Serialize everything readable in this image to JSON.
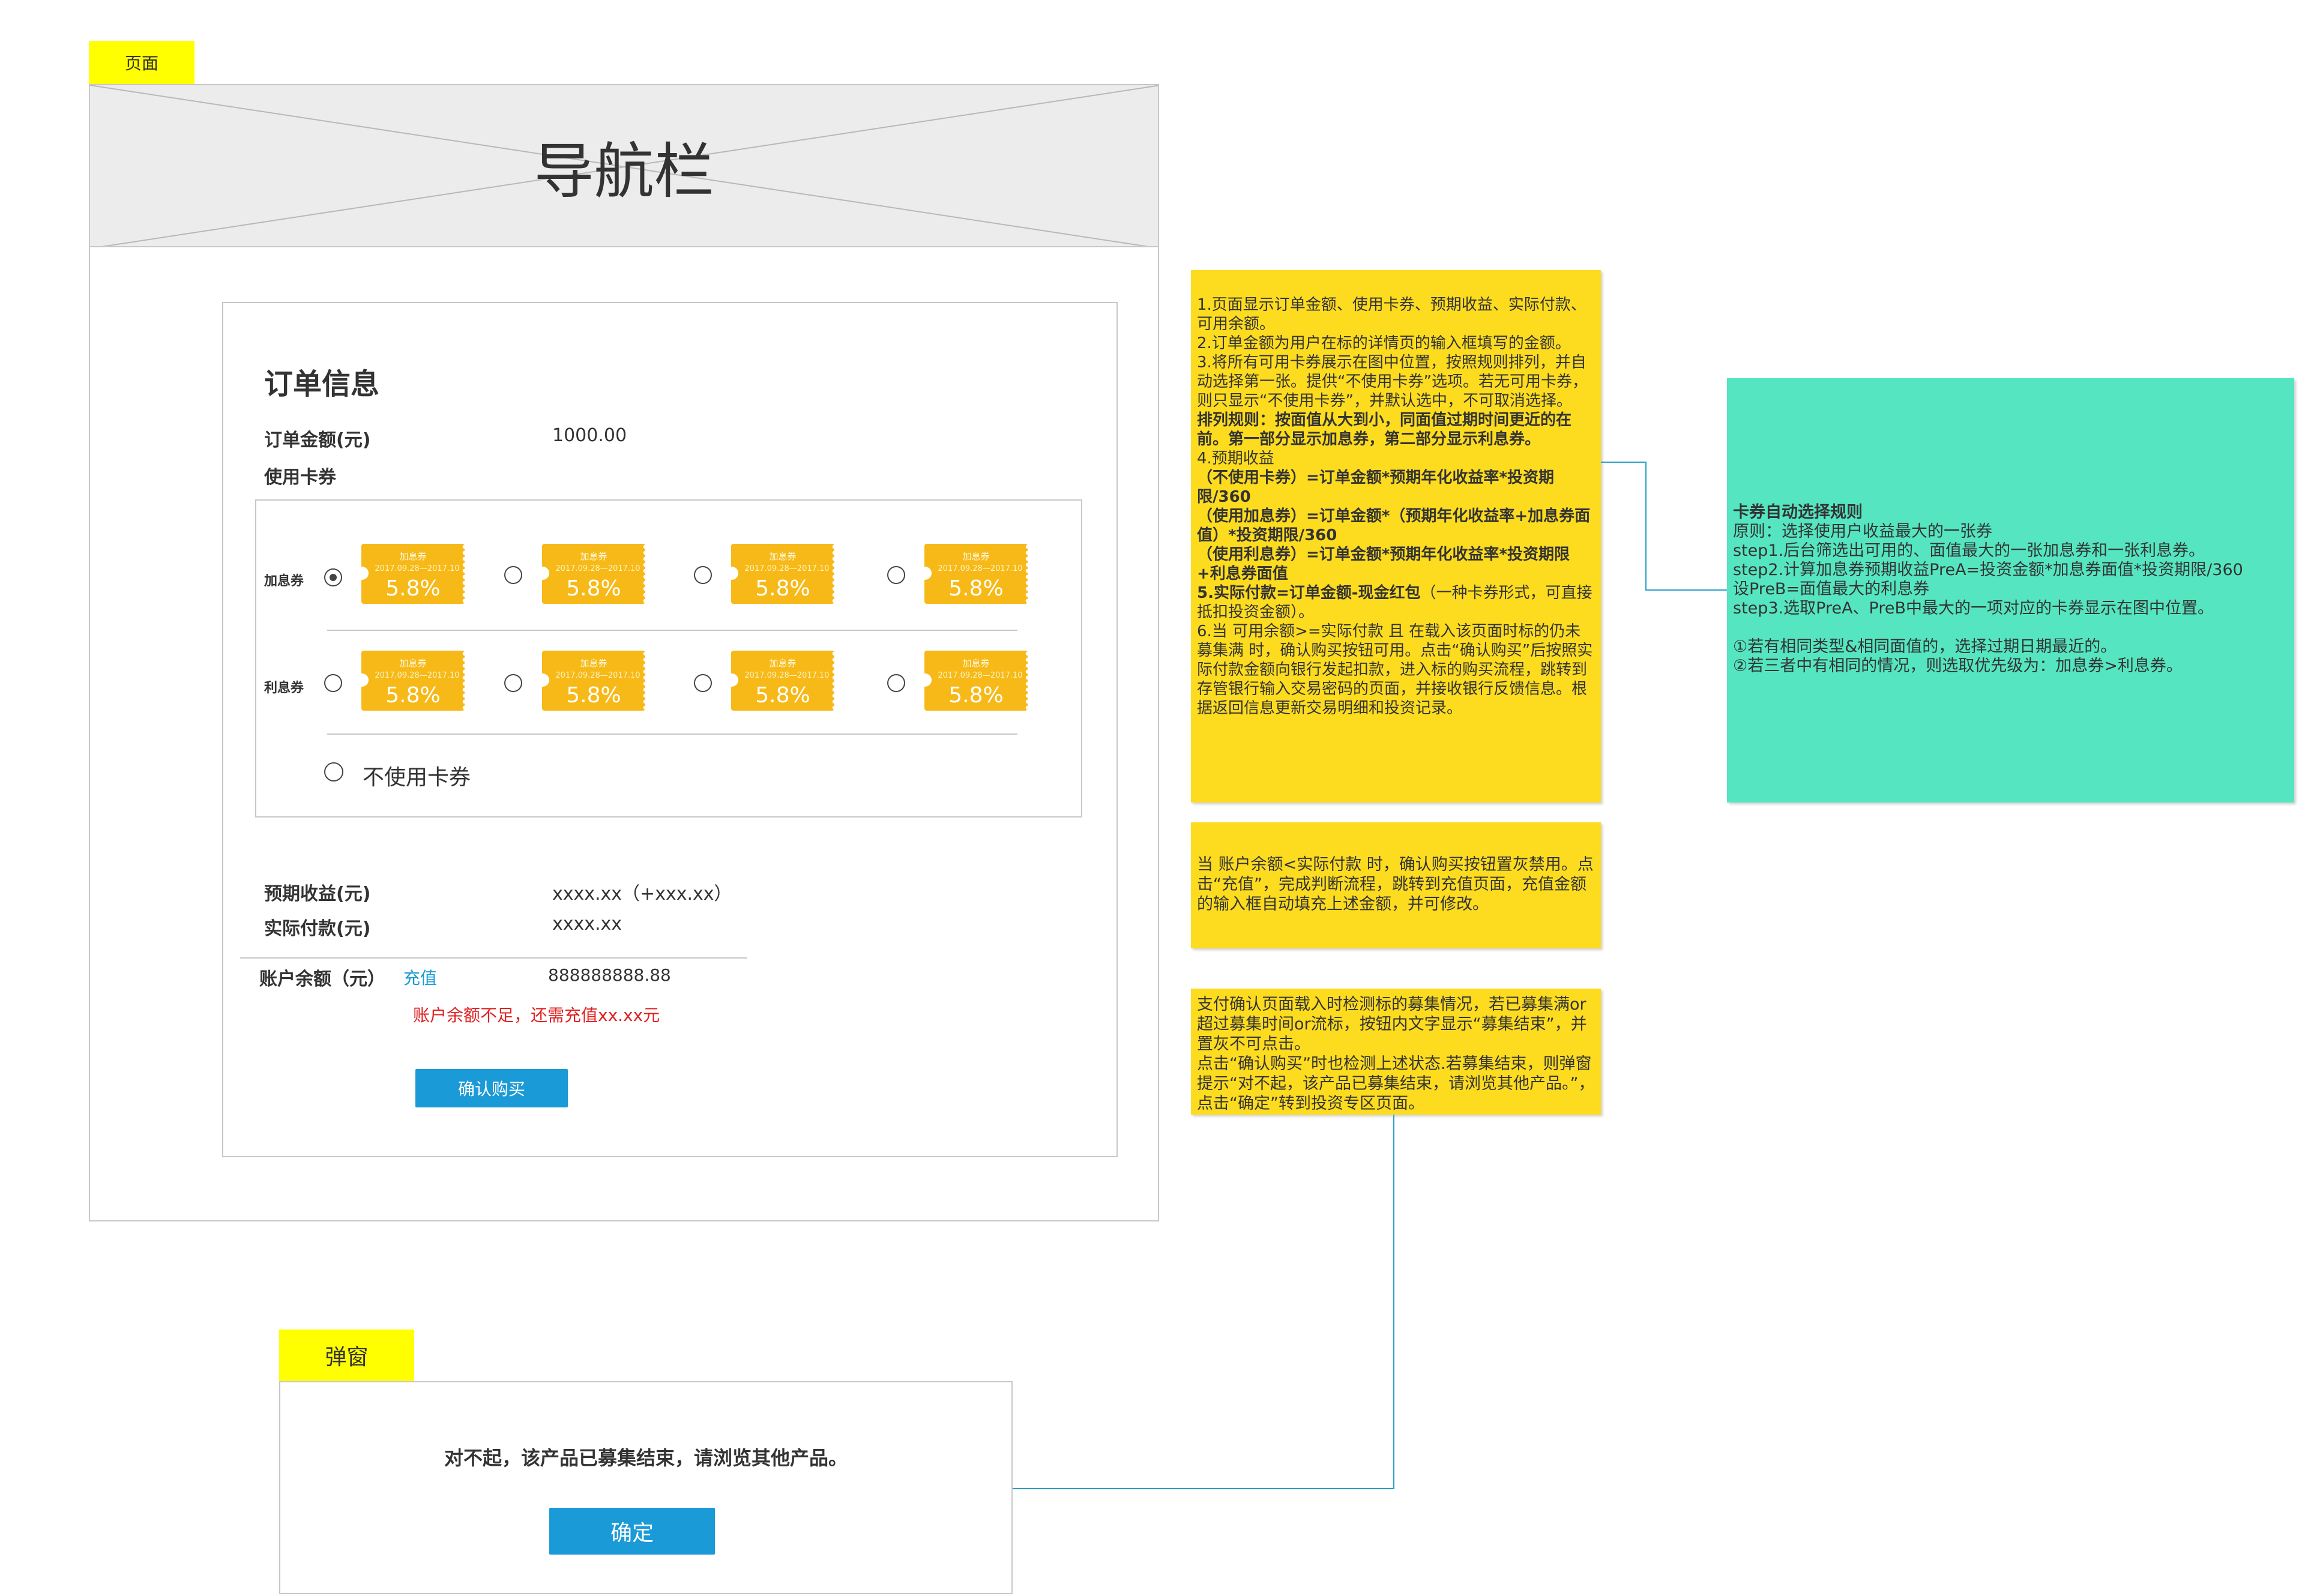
{
  "labels": {
    "page_tag": "页面",
    "popup_tag": "弹窗"
  },
  "navbar": {
    "title": "导航栏"
  },
  "order": {
    "section_title": "订单信息",
    "amount_label": "订单金额(元)",
    "amount_value": "1000.00",
    "coupon_label": "使用卡券",
    "row_jiaxi_label": "加息券",
    "row_lixi_label": "利息券",
    "coupon_title": "加息券",
    "coupon_date": "2017.09.28—2017.10",
    "coupon_value": "5.8%",
    "no_coupon_label": "不使用卡券",
    "expected_label": "预期收益(元)",
    "expected_value": "xxxx.xx（+xxx.xx）",
    "actual_label": "实际付款(元)",
    "actual_value": "xxxx.xx",
    "balance_label": "账户余额（元）",
    "recharge_link": "充值",
    "balance_value": "888888888.88",
    "insufficient_msg": "账户余额不足，还需充值xx.xx元",
    "confirm_button": "确认购买"
  },
  "popup": {
    "message": "对不起，该产品已募集结束，请浏览其他产品。",
    "ok_button": "确定"
  },
  "notes": {
    "note1": [
      {
        "t": "1.页面显示订单金额、使用卡券、预期收益、实际付款、可用余额。",
        "b": false
      },
      {
        "t": "2.订单金额为用户在标的详情页的输入框填写的金额。",
        "b": false
      },
      {
        "t": "3.将所有可用卡券展示在图中位置，按照规则排列，并自动选择第一张。提供“不使用卡券”选项。若无可用卡券，则只显示“不使用卡券”，并默认选中，不可取消选择。",
        "b": false
      },
      {
        "t": "排列规则：按面值从大到小，同面值过期时间更近的在前。第一部分显示加息券，第二部分显示利息券。",
        "b": true
      },
      {
        "t": "4.预期收益",
        "b": false
      },
      {
        "t": "（不使用卡券）=订单金额*预期年化收益率*投资期限/360",
        "b": true
      },
      {
        "t": "（使用加息券）=订单金额*（预期年化收益率+加息券面值）*投资期限/360",
        "b": true
      },
      {
        "t": "（使用利息券）=订单金额*预期年化收益率*投资期限+利息券面值",
        "b": true
      }
    ],
    "note1_item5_bold": "5.实际付款=订单金额-现金红包",
    "note1_item5_rest": "（一种卡券形式，可直接抵扣投资金额）。",
    "note1_item6": "6.当  可用余额>=实际付款  且  在载入该页面时标的仍未募集满  时，确认购买按钮可用。点击“确认购买”后按照实际付款金额向银行发起扣款，进入标的购买流程，跳转到存管银行输入交易密码的页面，并接收银行反馈信息。根据返回信息更新交易明细和投资记录。",
    "note2": "当 账户余额<实际付款  时，确认购买按钮置灰禁用。点击“充值”，完成判断流程，跳转到充值页面，充值金额的输入框自动填充上述金额，并可修改。",
    "note3_line1": "支付确认页面载入时检测标的募集情况，若已募集满or超过募集时间or流标，按钮内文字显示“募集结束”，并置灰不可点击。",
    "note3_line2": "点击“确认购买”时也检测上述状态.若募集结束，则弹窗提示“对不起，该产品已募集结束，请浏览其他产品。”，点击“确定”转到投资专区页面。",
    "green_title": "卡券自动选择规则",
    "green_lines": [
      "原则：选择使用户收益最大的一张券",
      "step1.后台筛选出可用的、面值最大的一张加息券和一张利息券。",
      "step2.计算加息券预期收益PreA=投资金额*加息券面值*投资期限/360",
      "设PreB=面值最大的利息券",
      "step3.选取PreA、PreB中最大的一项对应的卡券显示在图中位置。",
      "",
      "①若有相同类型&相同面值的，选择过期日期最近的。",
      "②若三者中有相同的情况，则选取优先级为：加息券>利息券。"
    ]
  },
  "colors": {
    "tag_yellow": "#ffff00",
    "note_yellow": "#fddc1f",
    "note_green": "#55e6c1",
    "coupon_orange": "#f6b918",
    "button_blue": "#1a9ad6",
    "link_blue": "#1a9ad6",
    "warning_red": "#e02020",
    "connector": "#2aa0c8"
  }
}
